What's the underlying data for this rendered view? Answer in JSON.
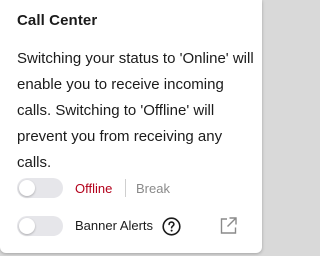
{
  "panel": {
    "title": "Call Center",
    "description": "Switching your status to 'Online' will enable you to receive incoming calls. Switching to 'Offline' will prevent you from receiving any calls."
  },
  "status": {
    "offline_label": "Offline",
    "break_label": "Break",
    "toggle_on": false
  },
  "banner_alerts": {
    "label": "Banner Alerts",
    "toggle_on": false
  },
  "icons": {
    "help": "help-icon",
    "external": "external-link-icon"
  },
  "colors": {
    "offline_red": "#b3001b",
    "muted": "#8a8a8a",
    "text": "#1b1b1b",
    "toggle_track": "#e6e6ea"
  }
}
